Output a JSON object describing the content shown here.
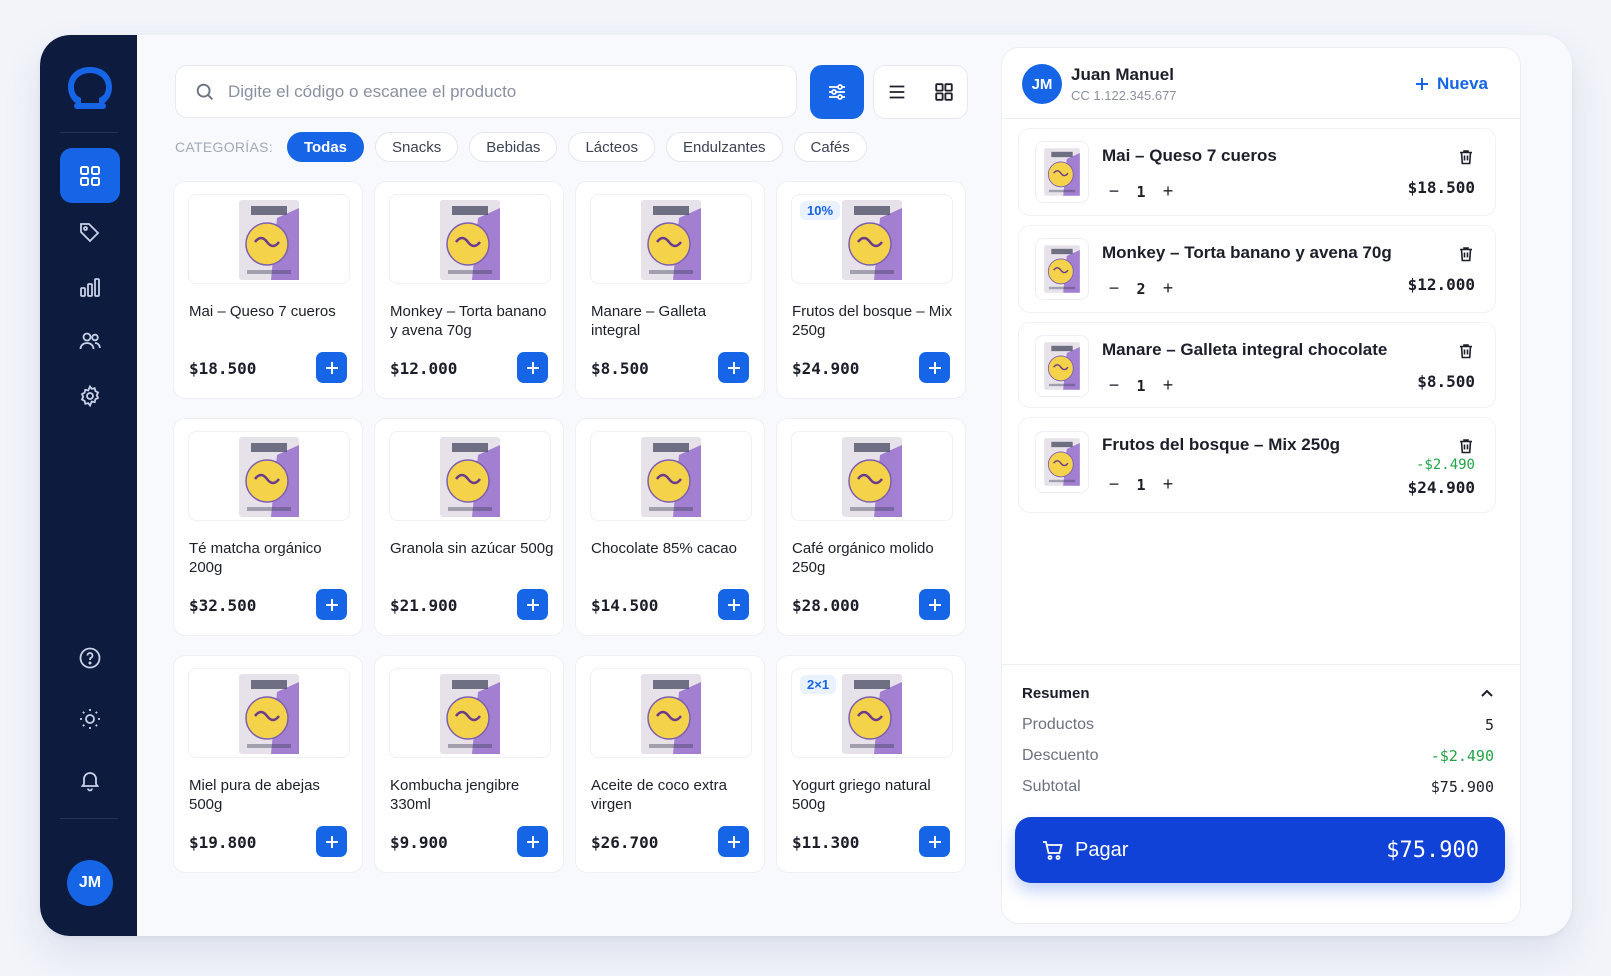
{
  "sidebar": {
    "avatar": "JM",
    "nav": [
      "dashboard-icon",
      "tag-icon",
      "chart-icon",
      "users-icon",
      "gear-icon"
    ],
    "bottom": [
      "help-icon",
      "sun-icon",
      "bell-icon"
    ]
  },
  "search": {
    "placeholder": "Digite el código o escanee el producto",
    "value": ""
  },
  "categories": {
    "label": "CATEGORÍAS:",
    "items": [
      "Todas",
      "Snacks",
      "Bebidas",
      "Lácteos",
      "Endulzantes",
      "Cafés"
    ],
    "active": "Todas"
  },
  "products": [
    {
      "name": "Mai – Queso 7 cueros",
      "price": "$18.500",
      "badge": ""
    },
    {
      "name": "Monkey – Torta banano y avena 70g",
      "price": "$12.000",
      "badge": ""
    },
    {
      "name": "Manare – Galleta integral",
      "price": "$8.500",
      "badge": ""
    },
    {
      "name": "Frutos del bosque – Mix 250g",
      "price": "$24.900",
      "badge": "10%"
    },
    {
      "name": "Té matcha orgánico 200g",
      "price": "$32.500",
      "badge": ""
    },
    {
      "name": "Granola sin azúcar 500g",
      "price": "$21.900",
      "badge": ""
    },
    {
      "name": "Chocolate 85% cacao",
      "price": "$14.500",
      "badge": ""
    },
    {
      "name": "Café orgánico molido 250g",
      "price": "$28.000",
      "badge": ""
    },
    {
      "name": "Miel pura de abejas 500g",
      "price": "$19.800",
      "badge": ""
    },
    {
      "name": "Kombucha jengibre 330ml",
      "price": "$9.900",
      "badge": ""
    },
    {
      "name": "Aceite de coco extra virgen",
      "price": "$26.700",
      "badge": ""
    },
    {
      "name": "Yogurt griego natural 500g",
      "price": "$11.300",
      "badge": "2×1"
    }
  ],
  "cart": {
    "customer": {
      "initials": "JM",
      "name": "Juan Manuel",
      "id": "CC 1.122.345.677"
    },
    "new_label": "Nueva",
    "items": [
      {
        "name": "Mai – Queso 7 cueros",
        "qty": "1",
        "price": "$18.500",
        "discount": ""
      },
      {
        "name": "Monkey – Torta banano y avena 70g",
        "qty": "2",
        "price": "$12.000",
        "discount": ""
      },
      {
        "name": "Manare – Galleta integral chocolate",
        "qty": "1",
        "price": "$8.500",
        "discount": ""
      },
      {
        "name": "Frutos del bosque – Mix 250g",
        "qty": "1",
        "price": "$24.900",
        "discount": "-$2.490"
      }
    ],
    "summary": {
      "title": "Resumen",
      "productos_label": "Productos",
      "productos": "5",
      "descuento_label": "Descuento",
      "descuento": "-$2.490",
      "subtotal_label": "Subtotal",
      "subtotal": "$75.900"
    },
    "pay": {
      "label": "Pagar",
      "amount": "$75.900"
    }
  },
  "colors": {
    "accent": "#1565e6",
    "sidebar": "#0d1b3e",
    "discount": "#22a447"
  }
}
